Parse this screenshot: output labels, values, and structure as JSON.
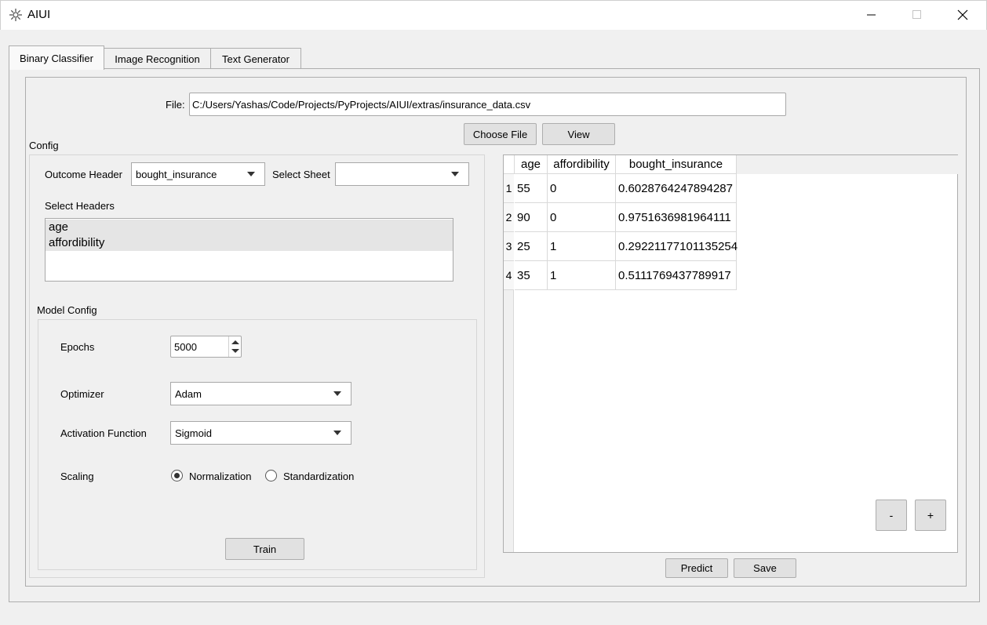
{
  "window": {
    "title": "AIUI"
  },
  "tabs": [
    {
      "label": "Binary Classifier"
    },
    {
      "label": "Image Recognition"
    },
    {
      "label": "Text Generator"
    }
  ],
  "file": {
    "label": "File:",
    "path": "C:/Users/Yashas/Code/Projects/PyProjects/AIUI/extras/insurance_data.csv",
    "choose_label": "Choose File",
    "view_label": "View"
  },
  "config": {
    "title": "Config",
    "outcome_header_label": "Outcome Header",
    "outcome_header_value": "bought_insurance",
    "select_sheet_label": "Select Sheet",
    "select_sheet_value": "",
    "select_headers_label": "Select Headers",
    "headers": [
      "age",
      "affordibility"
    ]
  },
  "model_config": {
    "title": "Model Config",
    "epochs_label": "Epochs",
    "epochs_value": "5000",
    "optimizer_label": "Optimizer",
    "optimizer_value": "Adam",
    "activation_label": "Activation Function",
    "activation_value": "Sigmoid",
    "scaling_label": "Scaling",
    "scaling_options": [
      "Normalization",
      "Standardization"
    ],
    "scaling_selected": "Normalization",
    "train_label": "Train"
  },
  "table": {
    "columns": [
      "age",
      "affordibility",
      "bought_insurance"
    ],
    "rows": [
      {
        "num": "1",
        "cells": [
          "55",
          "0",
          "0.6028764247894287"
        ]
      },
      {
        "num": "2",
        "cells": [
          "90",
          "0",
          "0.9751636981964111"
        ]
      },
      {
        "num": "3",
        "cells": [
          "25",
          "1",
          "0.29221177101135254"
        ]
      },
      {
        "num": "4",
        "cells": [
          "35",
          "1",
          "0.5111769437789917"
        ]
      }
    ],
    "remove_label": "-",
    "add_label": "+"
  },
  "actions": {
    "predict_label": "Predict",
    "save_label": "Save"
  },
  "colors": {
    "window_bg": "#f0f0f0",
    "button_bg": "#e1e1e1",
    "border": "#adadad"
  }
}
